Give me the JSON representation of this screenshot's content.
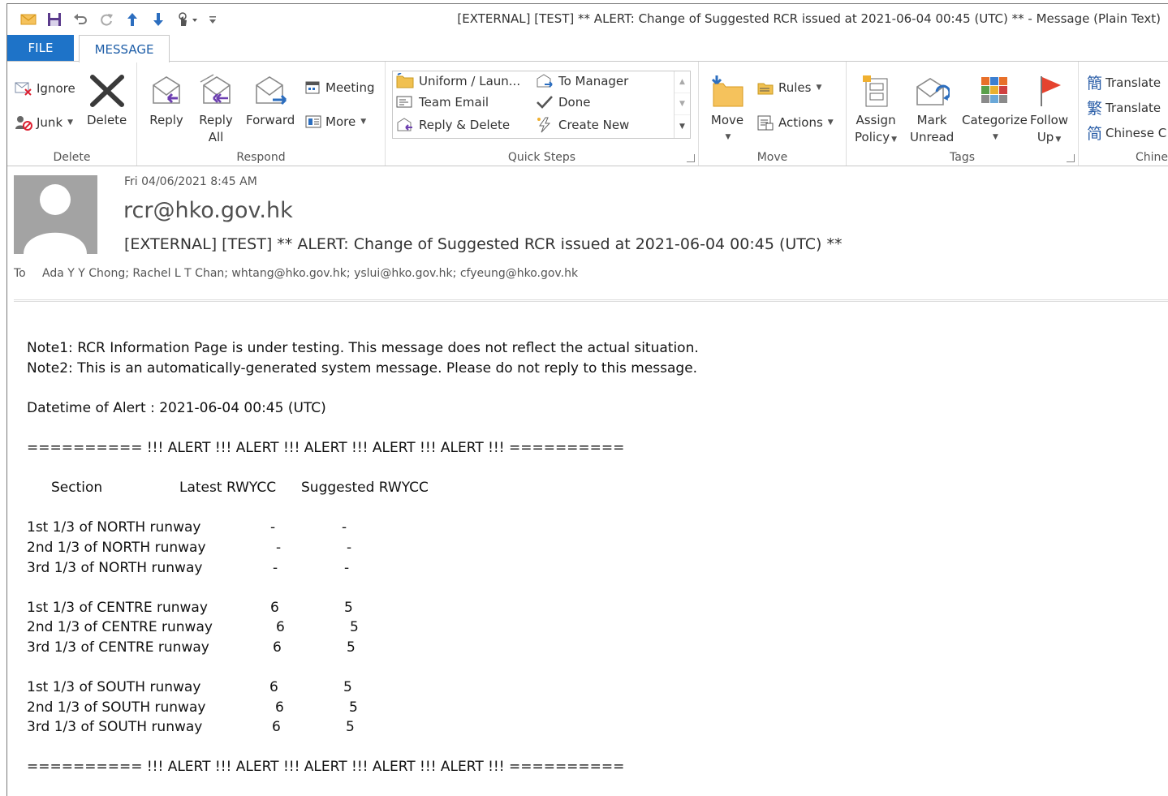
{
  "window": {
    "title": "[EXTERNAL] [TEST] ** ALERT: Change of Suggested RCR issued at 2021-06-04 00:45 (UTC) ** - Message (Plain Text)"
  },
  "tabs": {
    "file": "FILE",
    "message": "MESSAGE"
  },
  "ribbon": {
    "delete_group": {
      "label": "Delete",
      "ignore": "Ignore",
      "junk": "Junk",
      "delete": "Delete"
    },
    "respond_group": {
      "label": "Respond",
      "reply": "Reply",
      "reply_all_1": "Reply",
      "reply_all_2": "All",
      "forward": "Forward",
      "meeting": "Meeting",
      "more": "More"
    },
    "quicksteps_group": {
      "label": "Quick Steps",
      "uniform": "Uniform / Laun...",
      "team_email": "Team Email",
      "reply_delete": "Reply & Delete",
      "to_manager": "To Manager",
      "done": "Done",
      "create_new": "Create New"
    },
    "move_group": {
      "label": "Move",
      "move": "Move",
      "rules": "Rules",
      "actions": "Actions"
    },
    "tags_group": {
      "label": "Tags",
      "assign_1": "Assign",
      "assign_2": "Policy",
      "mark_1": "Mark",
      "mark_2": "Unread",
      "categorize": "Categorize",
      "follow_1": "Follow",
      "follow_2": "Up"
    },
    "chinese_group": {
      "label": "Chine",
      "translate_1": "Translate",
      "translate_2": "Translate",
      "chinese_conv": "Chinese C"
    }
  },
  "header": {
    "date": "Fri 04/06/2021 8:45 AM",
    "sender": "rcr@hko.gov.hk",
    "subject": "[EXTERNAL] [TEST] ** ALERT: Change of Suggested RCR issued at 2021-06-04 00:45 (UTC) **",
    "to_label": "To",
    "recipients": "Ada Y Y Chong; Rachel L T Chan; whtang@hko.gov.hk; yslui@hko.gov.hk; cfyeung@hko.gov.hk"
  },
  "body": {
    "note1": "Note1: RCR Information Page is under testing. This message does not reflect the actual situation.",
    "note2": "Note2: This is an automatically-generated system message. Please do not reply to this message.",
    "datetime": "Datetime of Alert : 2021-06-04 00:45 (UTC)",
    "alert_banner": "========== !!! ALERT !!! ALERT !!! ALERT !!! ALERT !!! ALERT !!! ==========",
    "columns": [
      "Section",
      "Latest RWYCC",
      "Suggested RWYCC"
    ],
    "runways": [
      [
        {
          "section": "1st 1/3 of NORTH  runway",
          "latest": "-",
          "suggested": "-"
        },
        {
          "section": "2nd 1/3 of NORTH  runway",
          "latest": "-",
          "suggested": "-"
        },
        {
          "section": "3rd 1/3 of NORTH  runway",
          "latest": "-",
          "suggested": "-"
        }
      ],
      [
        {
          "section": "1st 1/3 of CENTRE runway",
          "latest": "6",
          "suggested": "5"
        },
        {
          "section": "2nd 1/3 of CENTRE runway",
          "latest": "6",
          "suggested": "5"
        },
        {
          "section": "3rd 1/3 of CENTRE runway",
          "latest": "6",
          "suggested": "5"
        }
      ],
      [
        {
          "section": "1st 1/3 of SOUTH  runway",
          "latest": "6",
          "suggested": "5"
        },
        {
          "section": "2nd 1/3 of SOUTH  runway",
          "latest": "6",
          "suggested": "5"
        },
        {
          "section": "3rd 1/3 of SOUTH  runway",
          "latest": "6",
          "suggested": "5"
        }
      ]
    ]
  }
}
